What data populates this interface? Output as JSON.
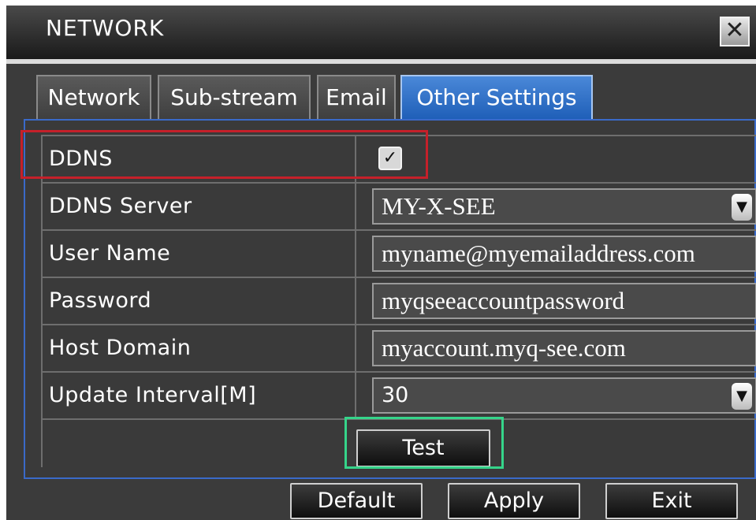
{
  "window": {
    "title": "NETWORK",
    "close_symbol": "✕"
  },
  "tabs": [
    {
      "label": "Network",
      "active": false
    },
    {
      "label": "Sub-stream",
      "active": false
    },
    {
      "label": "Email",
      "active": false
    },
    {
      "label": "Other Settings",
      "active": true
    }
  ],
  "form": {
    "ddns_label": "DDNS",
    "ddns_checked": true,
    "ddns_check_symbol": "✓",
    "ddns_server_label": "DDNS Server",
    "ddns_server_value": "MY-X-SEE",
    "user_name_label": "User Name",
    "user_name_value": "myname@myemailaddress.com",
    "password_label": "Password",
    "password_value": "myqseeaccountpassword",
    "host_domain_label": "Host Domain",
    "host_domain_value": "myaccount.myq-see.com",
    "update_interval_label": "Update Interval[M]",
    "update_interval_value": "30",
    "dropdown_arrow": "▼"
  },
  "buttons": {
    "test": "Test",
    "default": "Default",
    "apply": "Apply",
    "exit": "Exit"
  },
  "colors": {
    "active_tab": "#2a6cc8",
    "panel_border": "#3a6ac9",
    "highlight_red": "#c5202a",
    "highlight_green": "#35d48a"
  },
  "icons": {
    "close": "close-icon",
    "checkbox": "checkmark-icon",
    "dropdown": "chevron-down-icon"
  }
}
